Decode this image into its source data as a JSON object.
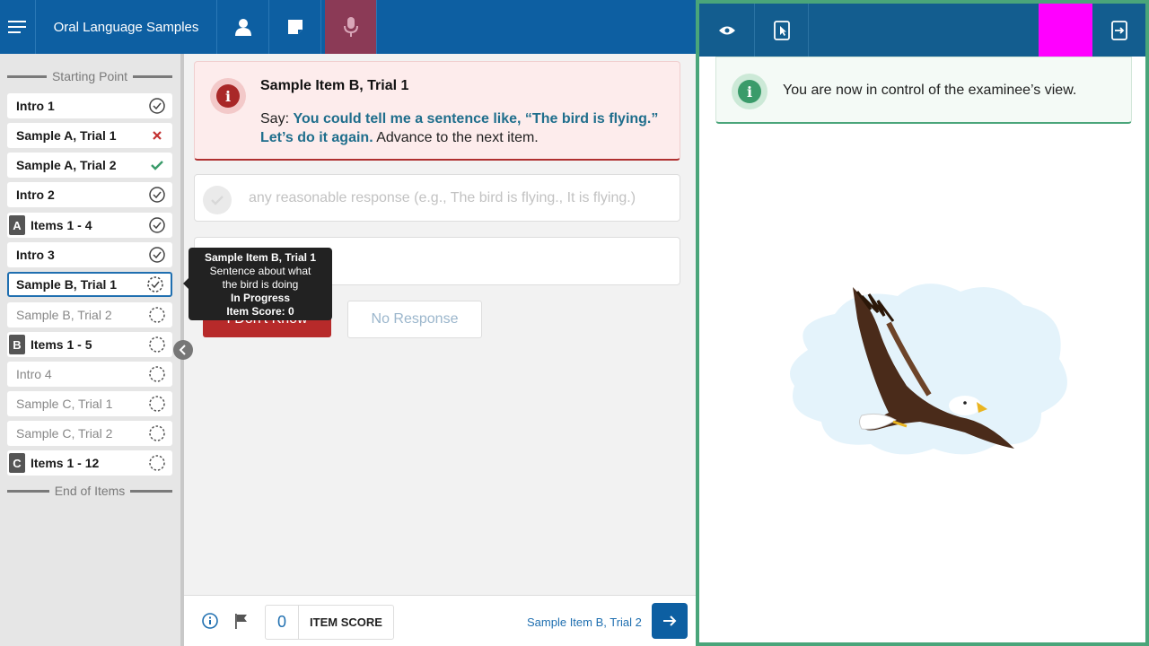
{
  "header": {
    "menu_icon": "hamburger-icon",
    "app_title": "Oral Language Samples",
    "icons": [
      "person-icon",
      "notes-icon",
      "microphone-icon"
    ],
    "active_tab_color": "#8b3a56",
    "bar_color": "#0d5fa2"
  },
  "sidebar": {
    "start_label": "Starting Point",
    "end_label": "End of Items",
    "items": [
      {
        "label": "Intro 1",
        "badge": "",
        "status": "complete"
      },
      {
        "label": "Sample A, Trial 1",
        "badge": "",
        "status": "incorrect"
      },
      {
        "label": "Sample A, Trial 2",
        "badge": "",
        "status": "correct"
      },
      {
        "label": "Intro 2",
        "badge": "",
        "status": "complete"
      },
      {
        "label": "Items 1 - 4",
        "badge": "A",
        "status": "complete"
      },
      {
        "label": "Intro 3",
        "badge": "",
        "status": "complete"
      },
      {
        "label": "Sample B, Trial 1",
        "badge": "",
        "status": "in-progress"
      },
      {
        "label": "Sample B, Trial 2",
        "badge": "",
        "status": "not-started"
      },
      {
        "label": "Items 1 - 5",
        "badge": "B",
        "status": "not-started"
      },
      {
        "label": "Intro 4",
        "badge": "",
        "status": "not-started"
      },
      {
        "label": "Sample C, Trial 1",
        "badge": "",
        "status": "not-started"
      },
      {
        "label": "Sample C, Trial 2",
        "badge": "",
        "status": "not-started"
      },
      {
        "label": "Items 1 - 12",
        "badge": "C",
        "status": "not-started"
      }
    ]
  },
  "tooltip": {
    "title": "Sample Item B, Trial 1",
    "line1": "Sentence about what",
    "line2": "the bird is doing",
    "status": "In Progress",
    "score": "Item Score: 0"
  },
  "alert": {
    "title": "Sample Item B, Trial 1",
    "say_prefix": "Say: ",
    "say_text": "You could tell me a sentence like, “The bird is flying.” Let’s do it again.",
    "after_text": " Advance to the next item.",
    "color": "#a92828"
  },
  "responses": {
    "correct_response": "any reasonable response (e.g., The bird is flying., It is flying.)"
  },
  "buttons": {
    "dont_know": "I Don't Know",
    "no_response": "No Response"
  },
  "footer": {
    "score_value": "0",
    "score_label": "ITEM SCORE",
    "next_item": "Sample Item B, Trial 2"
  },
  "examinee_panel": {
    "icons": [
      "eye-icon",
      "tablet-touch-icon",
      "exit-device-icon"
    ],
    "message": "You are now in control of the examinee’s view.",
    "border_color": "#4aa57a"
  }
}
